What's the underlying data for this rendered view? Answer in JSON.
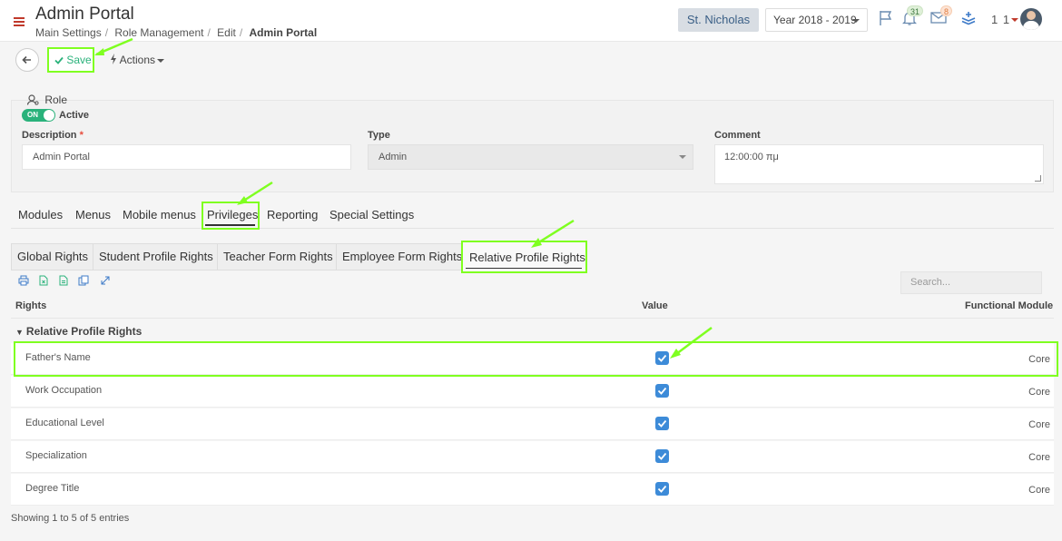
{
  "header": {
    "title": "Admin Portal",
    "breadcrumbs": [
      "Main Settings",
      "Role Management",
      "Edit",
      "Admin Portal"
    ],
    "school": "St. Nicholas",
    "year": "Year 2018 - 2019",
    "notifications_count": "31",
    "messages_count": "8",
    "user_num": "1 1"
  },
  "toolbar": {
    "save_label": "Save",
    "actions_label": "Actions"
  },
  "role": {
    "section_title": "Role",
    "toggle_label": "ON",
    "active_label": "Active",
    "description_label": "Description",
    "description_value": "Admin Portal",
    "type_label": "Type",
    "type_value": "Admin",
    "comment_label": "Comment",
    "comment_value": "12:00:00 πμ"
  },
  "tabs": [
    "Modules",
    "Menus",
    "Mobile menus",
    "Privileges",
    "Reporting",
    "Special Settings"
  ],
  "subtabs": [
    "Global Rights",
    "Student Profile Rights",
    "Teacher Form Rights",
    "Employee Form Rights",
    "Relative Profile Rights"
  ],
  "table": {
    "search_placeholder": "Search...",
    "columns": [
      "Rights",
      "Value",
      "Functional Module"
    ],
    "group": "Relative Profile Rights",
    "rows": [
      {
        "name": "Father's Name",
        "checked": true,
        "module": "Core"
      },
      {
        "name": "Work Occupation",
        "checked": true,
        "module": "Core"
      },
      {
        "name": "Educational Level",
        "checked": true,
        "module": "Core"
      },
      {
        "name": "Specialization",
        "checked": true,
        "module": "Core"
      },
      {
        "name": "Degree Title",
        "checked": true,
        "module": "Core"
      }
    ],
    "footer": "Showing 1 to 5 of 5 entries"
  },
  "colors": {
    "accent": "#2ab27b",
    "highlight": "#7fff20",
    "checkbox": "#3d8bd8",
    "menu_red": "#c0392b"
  }
}
